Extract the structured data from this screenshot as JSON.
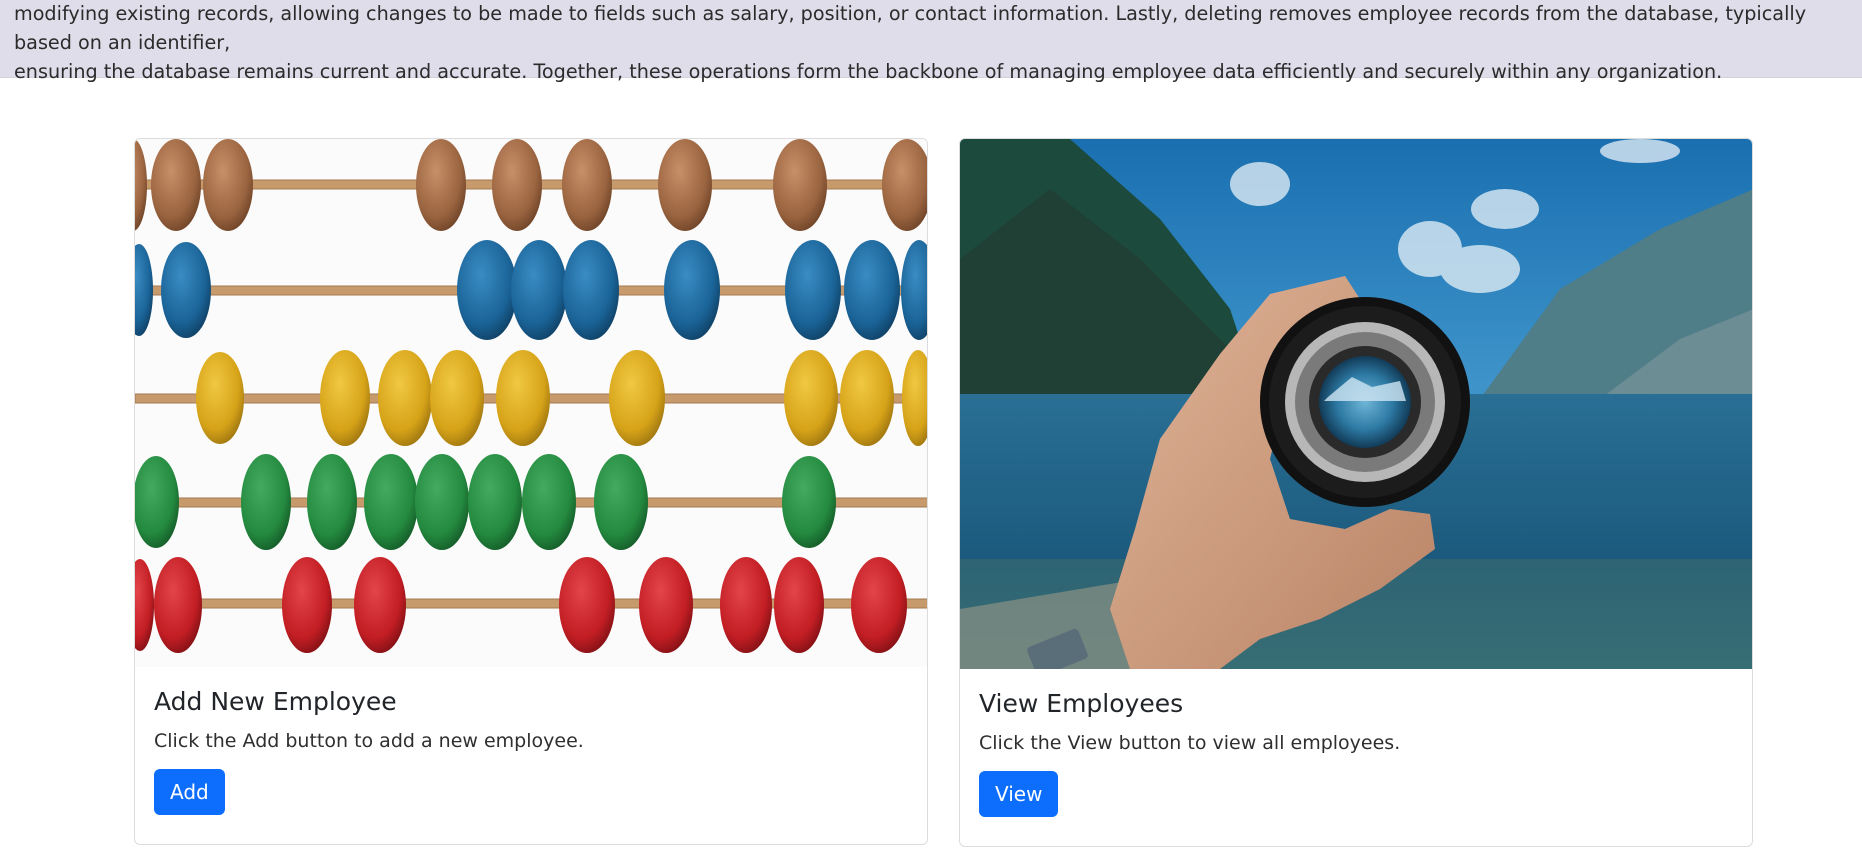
{
  "intro": {
    "line1": "modifying existing records, allowing changes to be made to fields such as salary, position, or contact information. Lastly, deleting removes employee records from the database, typically based on an identifier,",
    "line2": "ensuring the database remains current and accurate. Together, these operations form the backbone of managing employee data efficiently and securely within any organization."
  },
  "cards": {
    "add": {
      "title": "Add New Employee",
      "text": "Click the Add button to add a new employee.",
      "button_label": "Add",
      "image_icon": "abacus-image"
    },
    "view": {
      "title": "View Employees",
      "text": "Click the View button to view all employees.",
      "button_label": "View",
      "image_icon": "camera-lens-image"
    }
  },
  "colors": {
    "banner_bg": "#dfdde9",
    "button_bg": "#0d6efd",
    "bead_brown": "#a9704a",
    "bead_blue": "#1f6a9d",
    "bead_yellow": "#d9aa1f",
    "bead_green": "#2b8f45",
    "bead_red": "#c8252a"
  }
}
